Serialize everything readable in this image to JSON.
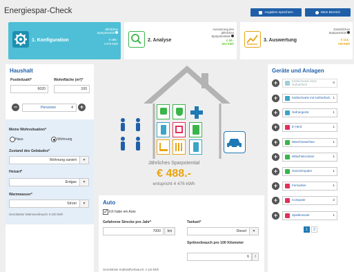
{
  "app": {
    "title": "Energiespar-Check",
    "btn_save": "Angaben speichern",
    "btn_account": "Mein Bereich"
  },
  "steps": [
    {
      "title": "1. Konfiguration",
      "info": [
        "Jährliches",
        "Sparpotential"
      ],
      "val1": "€ 488.-",
      "val2": "4 476 kWh"
    },
    {
      "title": "2. Analyse",
      "info": [
        "Ausnutzung des",
        "jährlichen",
        "Sparpotentials"
      ],
      "val1": "€ 60.-",
      "val2": "603 kWh"
    },
    {
      "title": "3. Auswertung",
      "info": [
        "Zusätzliches",
        "Sparpotential"
      ],
      "val1": "€ 114.-",
      "val2": "749 kWh"
    }
  ],
  "haushalt": {
    "title": "Haushalt",
    "plz_label": "Postleitzahl*",
    "plz_value": "6020",
    "area_label": "Wohnfläche (m²)*",
    "area_value": "100",
    "persons_label": "Personen",
    "persons_value": "4",
    "wohnsituation_label": "Meine Wohnsituation*",
    "opt_haus": "Haus",
    "opt_wohnung": "Wohnung",
    "zustand_label": "Zustand des Gebäudes*",
    "zustand_value": "Wohnung saniert",
    "heizart_label": "Heizart*",
    "heizart_value": "Erdgas",
    "warmwasser_label": "Warmwasser*",
    "warmwasser_value": "Strom",
    "hint": "Geschätzter Wärmeverbrauch: 9 230 kWh"
  },
  "center": {
    "caption": "Jährliches Sparpotential",
    "amount": "€ 488.-",
    "energy": "entspricht 4 476 kWh"
  },
  "auto": {
    "title": "Auto",
    "checkbox_label": "Ich habe ein Auto",
    "strecke_label": "Gefahrene Strecke pro Jahr*",
    "strecke_value": "7000",
    "strecke_unit": "km",
    "tankart_label": "Tankart*",
    "tankart_value": "Diesel",
    "sprit_label": "Spritverbrauch pro 100 Kilometer",
    "sprit_value": "6",
    "sprit_unit": "l",
    "hint": "Geschätzter Kraftstoffverbrauch: 4 116 kWh"
  },
  "geraete": {
    "title": "Geräte und Anlagen",
    "items": [
      {
        "name": "Kühlschrank ohne Gefrierfach",
        "count": "0",
        "color": "#9ecfd8",
        "grey": true
      },
      {
        "name": "Kühlschrank mit Gefrierfach",
        "count": "1",
        "color": "#3aa5c9",
        "grey": false
      },
      {
        "name": "Gefriergerät",
        "count": "1",
        "color": "#3aa5c9",
        "grey": false
      },
      {
        "name": "E-Herd",
        "count": "1",
        "color": "#e0305a",
        "grey": false
      },
      {
        "name": "Waschmaschine",
        "count": "1",
        "color": "#39b54a",
        "grey": false
      },
      {
        "name": "Wäschetrockner",
        "count": "1",
        "color": "#39b54a",
        "grey": false
      },
      {
        "name": "Geschirrspüler",
        "count": "1",
        "color": "#39b54a",
        "grey": false
      },
      {
        "name": "Fernseher",
        "count": "1",
        "color": "#e0305a",
        "grey": false
      },
      {
        "name": "Computer",
        "count": "2",
        "color": "#e0305a",
        "grey": false
      },
      {
        "name": "Spielkonsole",
        "count": "1",
        "color": "#e0305a",
        "grey": false
      }
    ],
    "pages": [
      "1",
      "2"
    ]
  },
  "colors": {
    "accent": "#1f5fa8",
    "active_step": "#4ebfd6",
    "amount": "#e8a312",
    "positive": "#66cc33"
  }
}
